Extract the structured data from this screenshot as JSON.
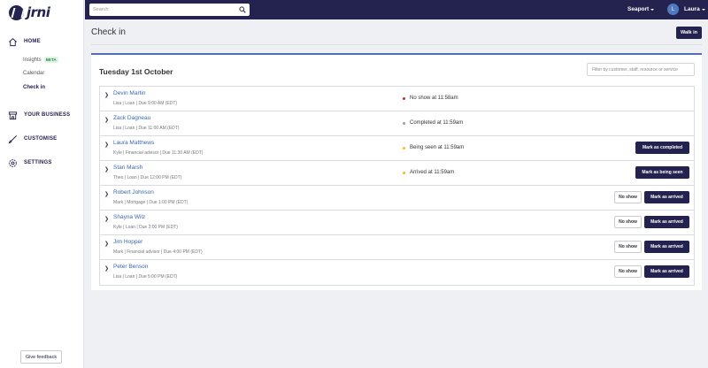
{
  "brand": {
    "name": "jrni"
  },
  "sidebar": {
    "sections": [
      {
        "label": "HOME",
        "icon": "home-icon"
      },
      {
        "label": "YOUR BUSINESS",
        "icon": "store-icon"
      },
      {
        "label": "CUSTOMISE",
        "icon": "brush-icon"
      },
      {
        "label": "SETTINGS",
        "icon": "gear-icon"
      }
    ],
    "home_items": [
      {
        "label": "Insights",
        "badge": "BETA"
      },
      {
        "label": "Calendar"
      },
      {
        "label": "Check in"
      }
    ],
    "feedback_label": "Give feedback"
  },
  "topbar": {
    "search_placeholder": "Search",
    "location": "Seaport",
    "avatar_initial": "L",
    "user_name": "Laura"
  },
  "page": {
    "title": "Check in",
    "walkin_label": "Walk in",
    "date_heading": "Tuesday 1st October",
    "filter_placeholder": "Filter by customer, staff, resource or service"
  },
  "colors": {
    "brand": "#24224e",
    "link": "#3a67b5",
    "no_show": "#c62828",
    "completed": "#9e9e9e",
    "in_progress": "#f5b82e"
  },
  "appointments": [
    {
      "name": "Devin Martin",
      "meta": "Lisa | Loan | Due 9:00 AM (EDT)",
      "status": "No show at 11:58am",
      "dot": "#c62828"
    },
    {
      "name": "Zack Dagneau",
      "meta": "Lisa | Loan | Due 11:00 AM (EDT)",
      "status": "Completed at 11:59am",
      "dot": "#9e9e9e"
    },
    {
      "name": "Laura Matthews",
      "meta": "Kyle | Financial advisor | Due 11:30 AM (EDT)",
      "status": "Being seen at 11:59am",
      "dot": "#f5b82e",
      "action": "Mark as completed"
    },
    {
      "name": "Stan Marsh",
      "meta": "Theo | Loan | Due 12:00 PM (EDT)",
      "status": "Arrived at 11:59am",
      "dot": "#f5b82e",
      "action": "Mark as being seen"
    },
    {
      "name": "Robert Johnson",
      "meta": "Mark | Mortgage | Due 1:00 PM (EDT)",
      "secondary": "No show",
      "action": "Mark as arrived"
    },
    {
      "name": "Shayna Wilz",
      "meta": "Kyle | Loan | Due 2:00 PM (EDT)",
      "secondary": "No show",
      "action": "Mark as arrived"
    },
    {
      "name": "Jim Hopper",
      "meta": "Mark | Financial advisor | Due 4:00 PM (EDT)",
      "secondary": "No show",
      "action": "Mark as arrived"
    },
    {
      "name": "Peter Benson",
      "meta": "Lisa | Loan | Due 5:00 PM (EDT)",
      "secondary": "No show",
      "action": "Mark as arrived"
    }
  ]
}
